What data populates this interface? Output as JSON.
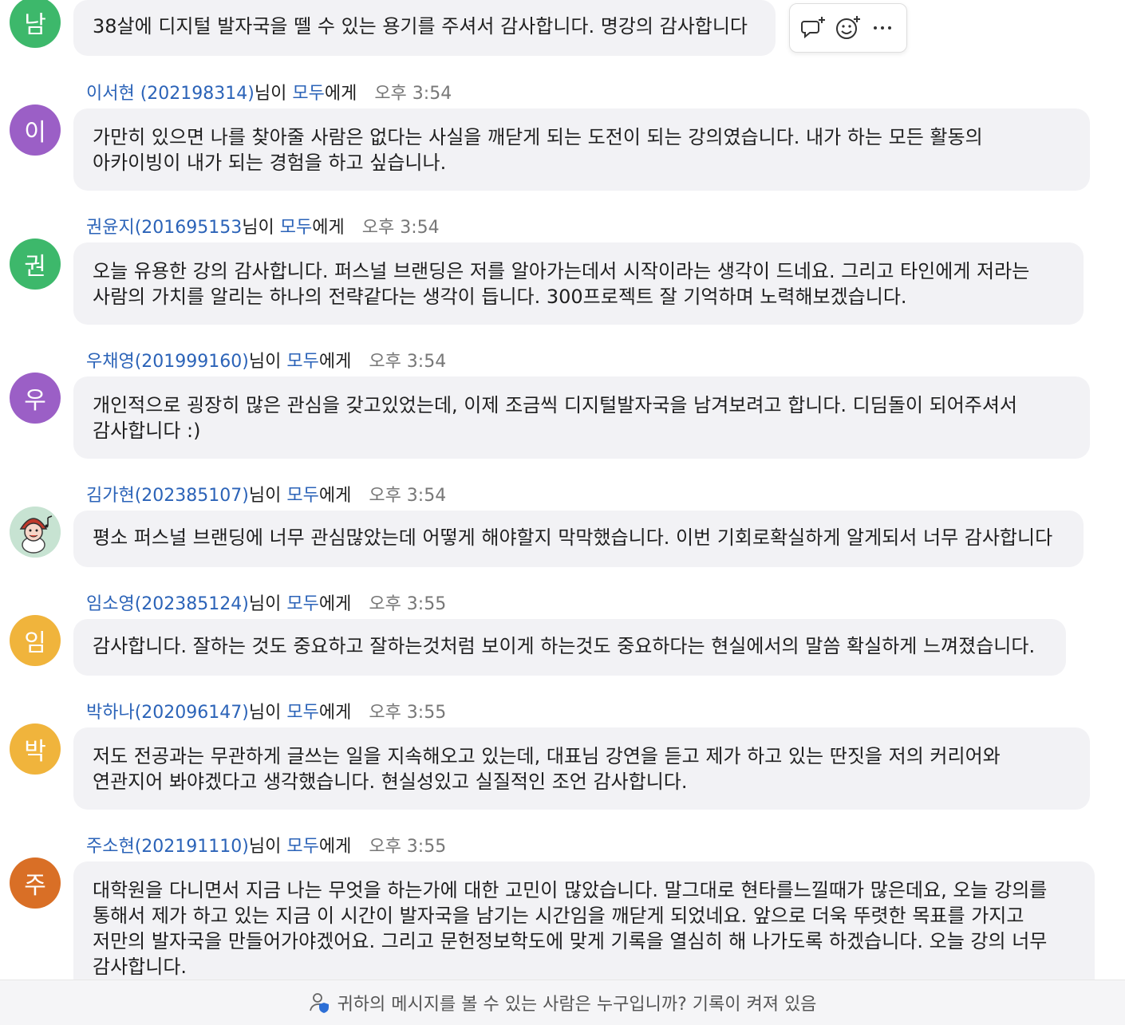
{
  "colors": {
    "link": "#2b63b8",
    "avatar_green": "#3db86b",
    "avatar_purple": "#9b5fc6",
    "avatar_yellow": "#f0b43c",
    "avatar_orange": "#d96f26",
    "bubble_bg": "#f2f2f5"
  },
  "hover_actions": {
    "reply_icon": "reply-thread-icon",
    "react_icon": "add-emoji-icon",
    "more_icon": "more-options-icon"
  },
  "messages": [
    {
      "avatar_char": "남",
      "text": "38살에 디지털 발자국을 뗄 수 있는 용기를 주셔서 감사합니다. 명강의 감사합니다"
    },
    {
      "avatar_char": "이",
      "sender": "이서현 (202198314)",
      "mid": "님이 ",
      "to": "모두",
      "tail": "에게",
      "time": "오후 3:54",
      "text": "가만히 있으면 나를 찾아줄 사람은 없다는 사실을 깨닫게 되는 도전이 되는 강의였습니다. 내가 하는 모든 활동의 아카이빙이 내가 되는 경험을 하고 싶습니나."
    },
    {
      "avatar_char": "권",
      "sender": "권윤지(201695153",
      "mid": "님이 ",
      "to": "모두",
      "tail": "에게",
      "time": "오후 3:54",
      "text": "오늘 유용한 강의 감사합니다. 퍼스널 브랜딩은 저를 알아가는데서 시작이라는 생각이 드네요. 그리고 타인에게 저라는 사람의 가치를 알리는 하나의 전략같다는 생각이 듭니다. 300프로젝트 잘 기억하며 노력해보겠습니다."
    },
    {
      "avatar_char": "우",
      "sender": "우채영(201999160)",
      "mid": "님이 ",
      "to": "모두",
      "tail": "에게",
      "time": "오후 3:54",
      "text": "개인적으로 굉장히 많은 관심을 갖고있었는데, 이제 조금씩 디지털발자국을 남겨보려고 합니다. 디딤돌이 되어주셔서 감사합니다 :)"
    },
    {
      "avatar_char": "",
      "sender": "김가현(202385107)",
      "mid": "님이 ",
      "to": "모두",
      "tail": "에게",
      "time": "오후 3:54",
      "text": "평소 퍼스널 브랜딩에 너무 관심많았는데 어떻게 해야할지 막막했습니다. 이번 기회로확실하게 알게되서 너무 감사합니다"
    },
    {
      "avatar_char": "임",
      "sender": "임소영(202385124)",
      "mid": "님이 ",
      "to": "모두",
      "tail": "에게",
      "time": "오후 3:55",
      "text": "감사합니다. 잘하는 것도 중요하고 잘하는것처럼 보이게 하는것도 중요하다는 현실에서의 말씀 확실하게 느껴졌습니다."
    },
    {
      "avatar_char": "박",
      "sender": "박하나(202096147)",
      "mid": "님이 ",
      "to": "모두",
      "tail": "에게",
      "time": "오후 3:55",
      "text": "저도 전공과는 무관하게 글쓰는 일을 지속해오고 있는데, 대표님 강연을 듣고 제가 하고 있는 딴짓을 저의 커리어와 연관지어 봐야겠다고 생각했습니다. 현실성있고 실질적인 조언 감사합니다."
    },
    {
      "avatar_char": "주",
      "sender": "주소현(202191110)",
      "mid": "님이 ",
      "to": "모두",
      "tail": "에게",
      "time": "오후 3:55",
      "text": "대학원을 다니면서 지금 나는 무엇을 하는가에 대한 고민이 많았습니다. 말그대로 현타를느낄때가 많은데요, 오늘 강의를 통해서 제가 하고 있는 지금 이 시간이 발자국을 남기는 시간임을 깨닫게 되었네요. 앞으로 더욱 뚜렷한 목표를 가지고 저만의 발자국을 만들어가야겠어요. 그리고 문헌정보학도에 맞게 기록을 열심히 해 나가도록 하겠습니다. 오늘 강의 너무 감사합니다."
    }
  ],
  "footer": {
    "icon": "visibility-shield-user-icon",
    "text": "귀하의 메시지를 볼 수 있는 사람은 누구입니까? 기록이 켜져 있음"
  }
}
